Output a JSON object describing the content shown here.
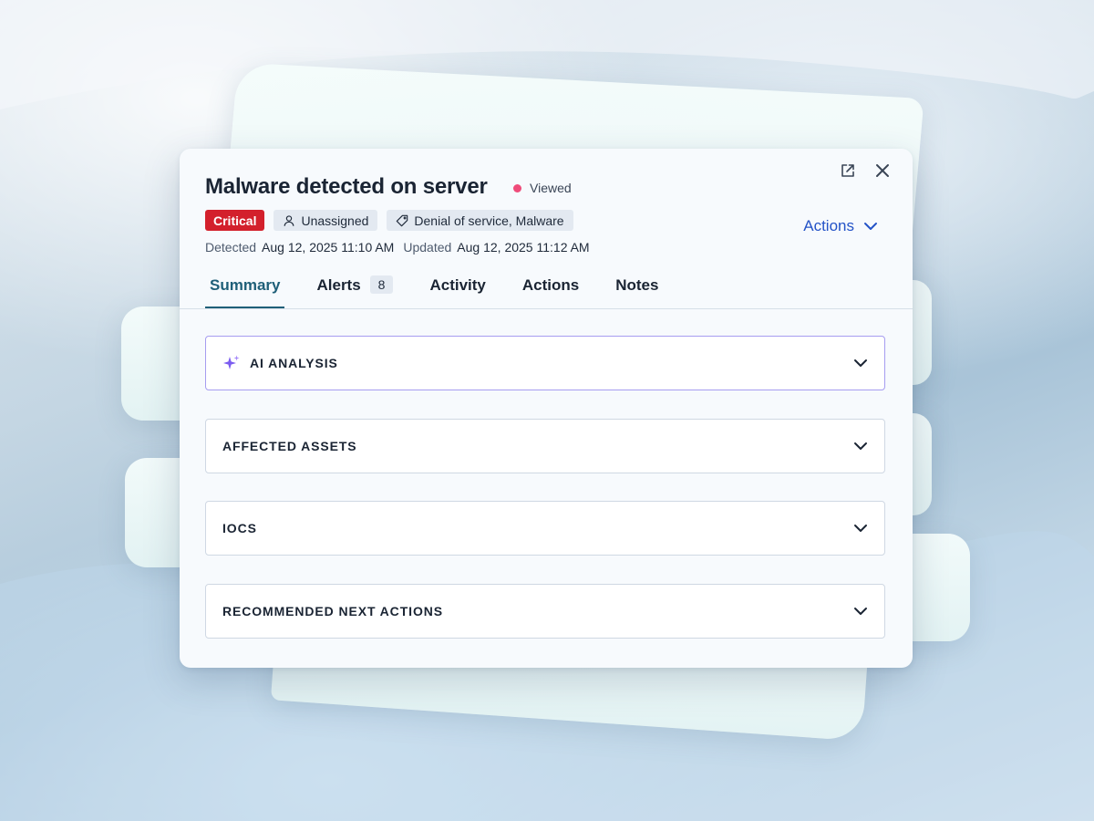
{
  "incident": {
    "title": "Malware detected on server",
    "status_text": "Viewed",
    "severity": "Critical",
    "assignee": "Unassigned",
    "tags": "Denial of service, Malware",
    "detected_label": "Detected",
    "detected_value": "Aug 12, 2025 11:10 AM",
    "updated_label": "Updated",
    "updated_value": "Aug 12, 2025 11:12 AM"
  },
  "header": {
    "actions_label": "Actions",
    "open_external_icon": "external-link-icon",
    "close_icon": "close-icon"
  },
  "tabs": [
    {
      "label": "Summary",
      "active": true
    },
    {
      "label": "Alerts",
      "badge": "8"
    },
    {
      "label": "Activity"
    },
    {
      "label": "Actions"
    },
    {
      "label": "Notes"
    }
  ],
  "sections": [
    {
      "label": "AI ANALYSIS",
      "icon": "sparkle-icon"
    },
    {
      "label": "AFFECTED ASSETS"
    },
    {
      "label": "IOCS"
    },
    {
      "label": "RECOMMENDED NEXT ACTIONS"
    }
  ],
  "colors": {
    "critical": "#d3202c",
    "accent_link": "#2453c7",
    "active_tab": "#1f5f78",
    "viewed_dot": "#ef4b7a",
    "ai_border": "#a69df0"
  }
}
